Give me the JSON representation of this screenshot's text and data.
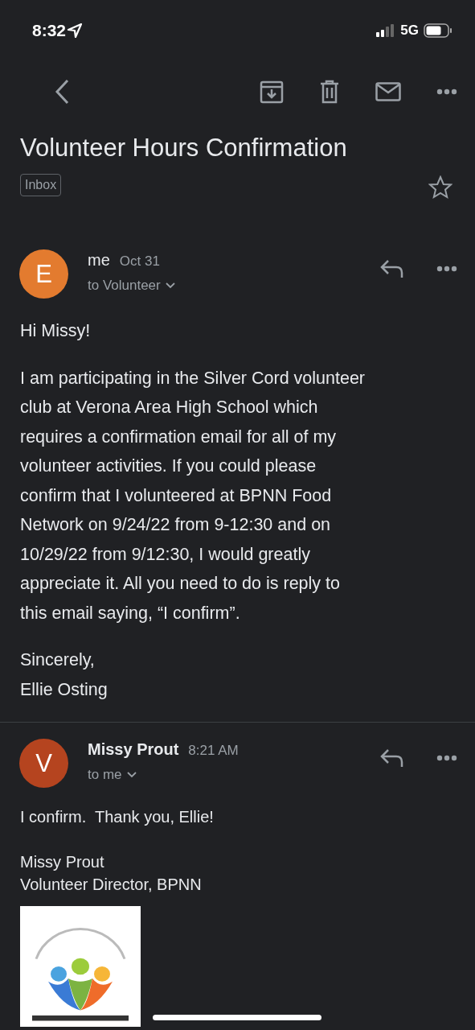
{
  "status_bar": {
    "time": "8:32",
    "network": "5G"
  },
  "subject": {
    "title": "Volunteer Hours Confirmation",
    "label": "Inbox",
    "starred": false
  },
  "messages": [
    {
      "initial": "E",
      "color": "#e37b2f",
      "sender": "me",
      "unread": false,
      "date": "Oct 31",
      "recipient": "to Volunteer",
      "body": [
        "Hi Missy!",
        "I am participating in the Silver Cord volunteer\nclub at Verona Area High School which\nrequires a confirmation email for all of my\nvolunteer activities. If you could please\nconfirm that I volunteered at BPNN Food\nNetwork on 9/24/22 from 9-12:30 and on\n10/29/22 from 9/12:30, I would greatly\nappreciate it. All you need to do is reply to\nthis email saying, “I confirm”.",
        "Sincerely,\nEllie Osting"
      ],
      "image": false
    },
    {
      "initial": "V",
      "color": "#b5441f",
      "sender": "Missy Prout",
      "unread": true,
      "date": "8:21 AM",
      "recipient": "to me",
      "body": [
        "I confirm.  Thank you, Ellie!",
        "Missy Prout\nVolunteer Director, BPNN"
      ],
      "image": true
    }
  ]
}
